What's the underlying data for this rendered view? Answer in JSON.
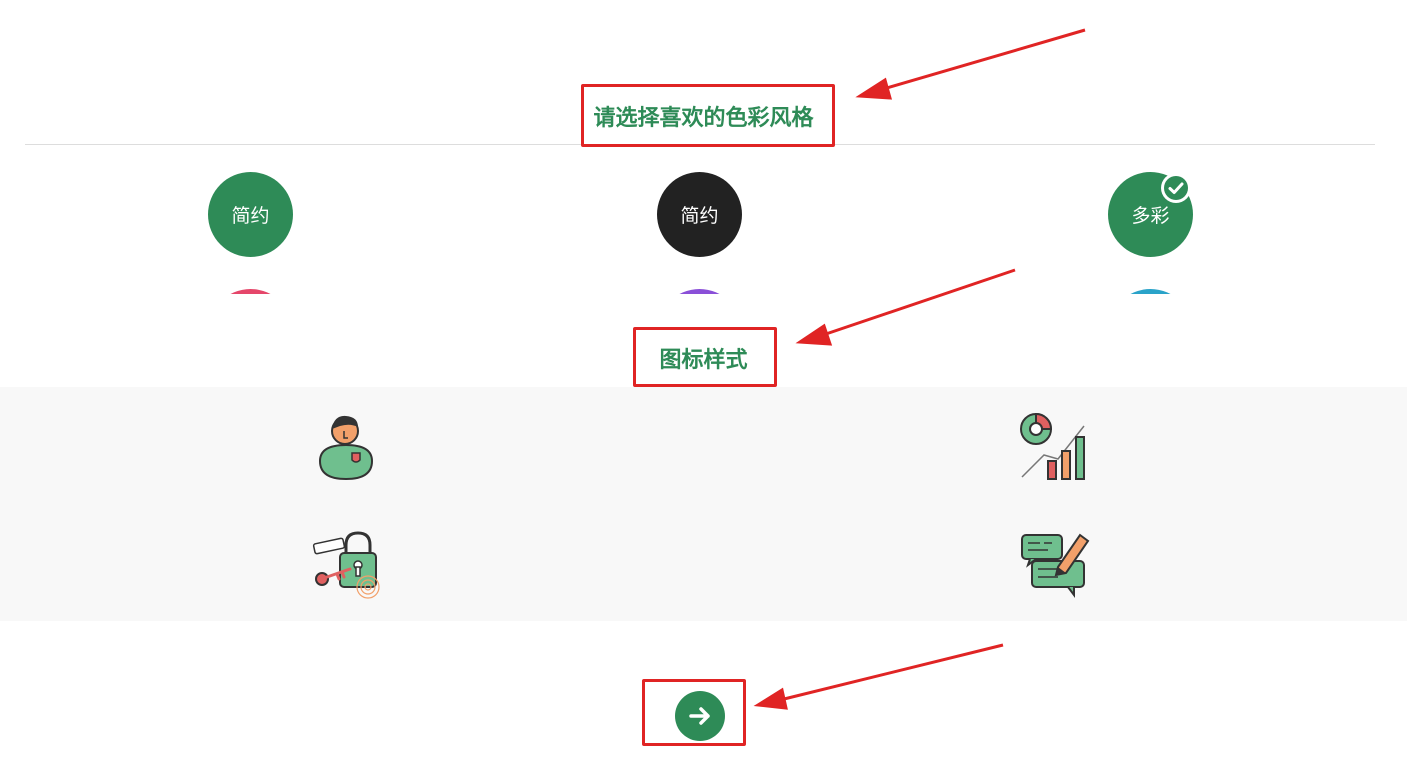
{
  "color_style": {
    "title": "请选择喜欢的色彩风格",
    "options": [
      {
        "label": "简约",
        "color": "#2e8b57",
        "selected": false
      },
      {
        "label": "简约",
        "color": "#222222",
        "selected": false
      },
      {
        "label": "多彩",
        "color": "#2e8b57",
        "selected": true
      }
    ],
    "partial_options": [
      {
        "color": "#e5466a"
      },
      {
        "color": "#8a4fd8"
      },
      {
        "color": "#2aa3c9"
      }
    ]
  },
  "icon_style": {
    "title": "图标样式",
    "icons": [
      "user-avatar-icon",
      "analytics-chart-icon",
      "security-lock-key-icon",
      "chat-edit-icon"
    ]
  },
  "next": {
    "icon": "arrow-right-icon"
  },
  "colors": {
    "accent": "#2e8b57",
    "annotation": "#e02424"
  }
}
